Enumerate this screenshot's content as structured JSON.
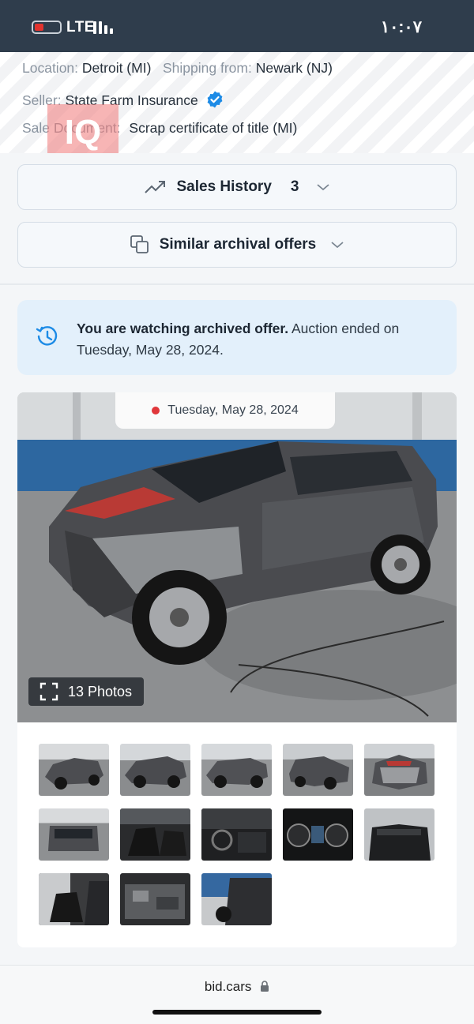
{
  "status_bar": {
    "network": "LTE",
    "time": "١٠:٠٧",
    "battery_color": "#e3342f"
  },
  "listing_info": {
    "location_label": "Location:",
    "location_value": "Detroit (MI)",
    "shipping_label": "Shipping from:",
    "shipping_value": "Newark (NJ)",
    "seller_label": "Seller:",
    "seller_value": "State Farm Insurance",
    "sale_document_label": "Sale Document:",
    "sale_document_value": "Scrap certificate of title (MI)",
    "watermark_text": "IQ"
  },
  "sales_history": {
    "label": "Sales History",
    "count": "3",
    "icon": "trending-up-icon"
  },
  "similar_offers": {
    "label": "Similar archival offers",
    "icon": "copy-icon"
  },
  "archived_notice": {
    "bold_text": "You are watching archived offer.",
    "text": " Auction ended on Tuesday, May 28, 2024."
  },
  "gallery": {
    "date": "Tuesday, May 28, 2024",
    "photos_label": "13 Photos",
    "thumbnails": [
      {
        "label": "exterior-front-left"
      },
      {
        "label": "exterior-side-left"
      },
      {
        "label": "exterior-side-left-2"
      },
      {
        "label": "exterior-front-right"
      },
      {
        "label": "exterior-front-damage"
      },
      {
        "label": "exterior-rear"
      },
      {
        "label": "interior-front-seats"
      },
      {
        "label": "interior-dashboard"
      },
      {
        "label": "instrument-cluster"
      },
      {
        "label": "interior-rear-seats"
      },
      {
        "label": "interior-rear-door"
      },
      {
        "label": "engine-bay"
      },
      {
        "label": "interior-door-panel"
      }
    ]
  },
  "browser": {
    "url": "bid.cars"
  },
  "colors": {
    "accent_blue": "#1d8be6",
    "status_bar": "#2f3d4c",
    "notice_bg": "#e3f0fb",
    "live_dot": "#e0363a"
  }
}
